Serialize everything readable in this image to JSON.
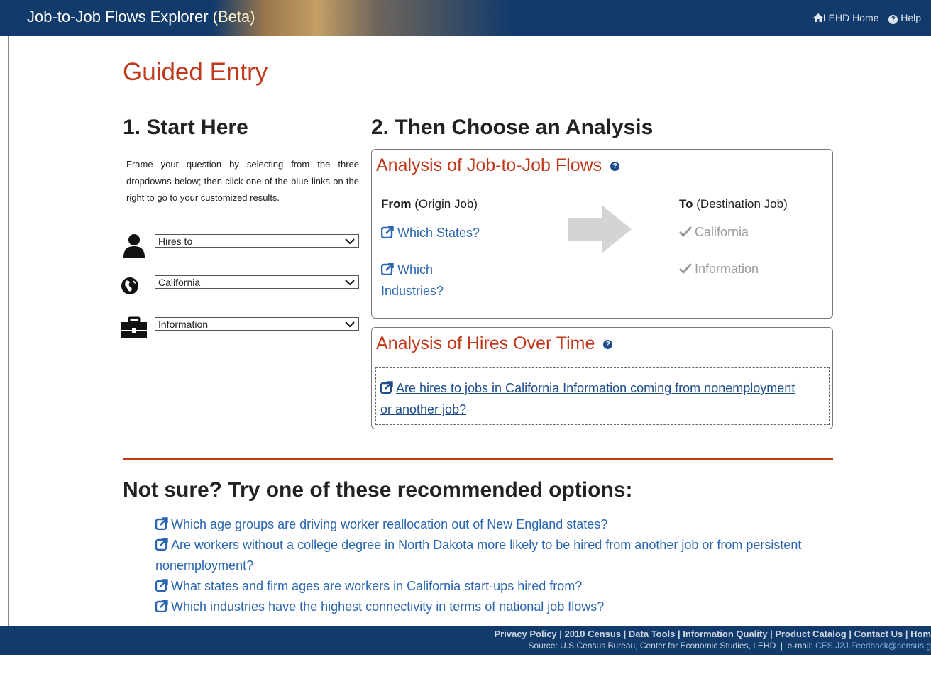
{
  "header": {
    "app_title": "Job-to-Job Flows Explorer",
    "beta": "(Beta)",
    "home_link": "LEHD Home",
    "help_link": "Help"
  },
  "page_title": "Guided Entry",
  "step1": {
    "heading": "1. Start Here",
    "instructions": "Frame your question by selecting from the three dropdowns below; then click one of the blue links on the right to go to your customized results.",
    "dropdowns": [
      {
        "icon": "person-icon",
        "value": "Hires to"
      },
      {
        "icon": "globe-icon",
        "value": "California"
      },
      {
        "icon": "briefcase-icon",
        "value": "Information"
      }
    ]
  },
  "step2": {
    "heading": "2. Then Choose an Analysis",
    "j2j": {
      "title": "Analysis of Job-to-Job Flows",
      "from_bold": "From",
      "from_rest": " (Origin Job)",
      "to_bold": "To",
      "to_rest": " (Destination Job)",
      "links": [
        "Which States?",
        "Which Industries?"
      ],
      "destinations": [
        "California",
        "Information"
      ]
    },
    "hires": {
      "title": "Analysis of Hires Over Time",
      "link": "Are hires to jobs in California Information coming from nonemployment or another job?"
    }
  },
  "recommended": {
    "heading": "Not sure? Try one of these recommended options:",
    "items": [
      "Which age groups are driving worker reallocation out of New England states?",
      "Are workers without a college degree in North Dakota more likely to be hired from another job or from persistent nonemployment?",
      "What states and firm ages are workers in California start-ups hired from?",
      "Which industries have the highest connectivity in terms of national job flows?"
    ]
  },
  "footer": {
    "links": [
      "Privacy Policy",
      "2010 Census",
      "Data Tools",
      "Information Quality",
      "Product Catalog",
      "Contact Us",
      "Hom"
    ],
    "source": "Source: U.S.Census Bureau, Center for Economic Studies, LEHD",
    "email_label": "e-mail:",
    "email": "CES.J2J.Feedback@census.g"
  },
  "colors": {
    "brand_navy": "#123a6b",
    "accent_red": "#c0391b",
    "link_blue": "#2a66b0"
  }
}
